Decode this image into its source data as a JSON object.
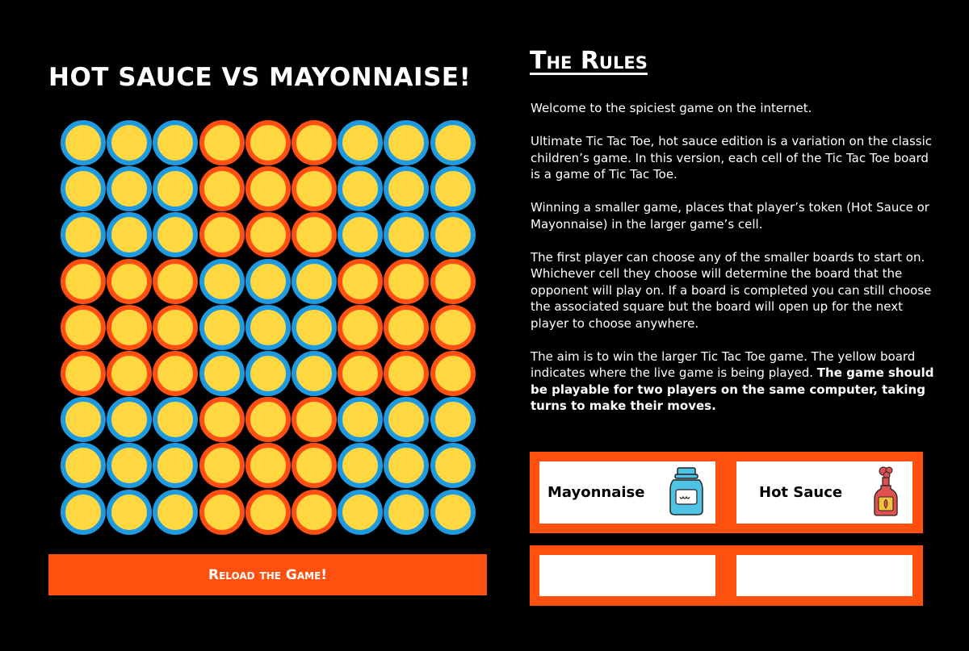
{
  "game": {
    "title": "Hot Sauce VS Mayonnaise!",
    "board_colors": {
      "cell_fill": "#ffd740",
      "blue_ring": "#1e9be0",
      "orange_ring": "#ff4f12"
    },
    "reload_label": "Reload the Game!"
  },
  "rules": {
    "title": "The Rules",
    "p1": "Welcome to the spiciest game on the internet.",
    "p2": "Ultimate Tic Tac Toe, hot sauce edition is a variation on the classic children’s game. In this version, each cell of the Tic Tac Toe board is a game of Tic Tac Toe.",
    "p3": "Winning a smaller game, places that player’s token (Hot Sauce or Mayonnaise) in the larger game’s cell.",
    "p4": "The first player can choose any of the smaller boards to start on. Whichever cell they choose will determine the board that the opponent will play on. If a board is completed you can still choose the associated square but the board will open up for the next player to choose anywhere.",
    "p5_normal": "The aim is to win the larger Tic Tac Toe game. The yellow board indicates where the live game is being played.",
    "p5_bold": "The game should be playable for two players on the same computer, taking turns to make their moves."
  },
  "players": {
    "mayo_label": "Mayonnaise",
    "mayo_icon": "mayonnaise-jar-icon",
    "hot_label": "Hot Sauce",
    "hot_icon": "hot-sauce-bottle-icon",
    "accent": "#ff5010"
  }
}
